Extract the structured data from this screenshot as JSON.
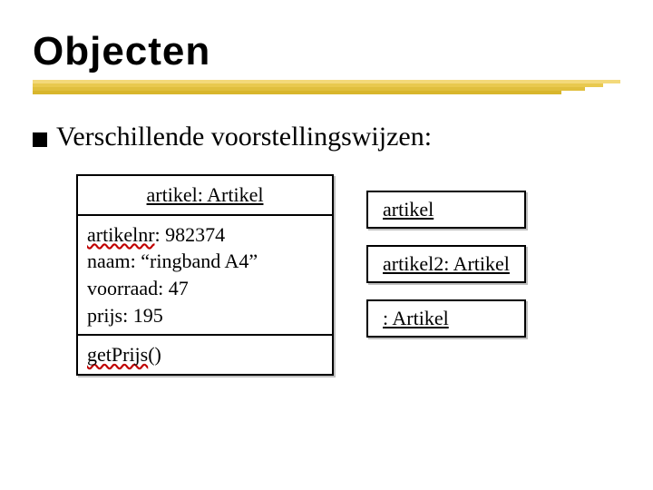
{
  "title": "Objecten",
  "subtitle": "Verschillende voorstellingswijzen:",
  "object_full": {
    "name_underlined": "artikel: Artikel",
    "attr_lines": {
      "l1_label_squiggle": "artikelnr",
      "l1_rest": ": 982374",
      "l2": "naam: “ringband A4”",
      "l3": "voorraad: 47",
      "l4": "prijs: 195"
    },
    "ops": {
      "op1_squiggle": "getPrijs",
      "op1_rest": "()"
    }
  },
  "short_boxes": {
    "b1_underlined_squiggle": "artikel",
    "b2_underlined": "artikel2: Artikel",
    "b3_underlined": ": Artikel"
  }
}
